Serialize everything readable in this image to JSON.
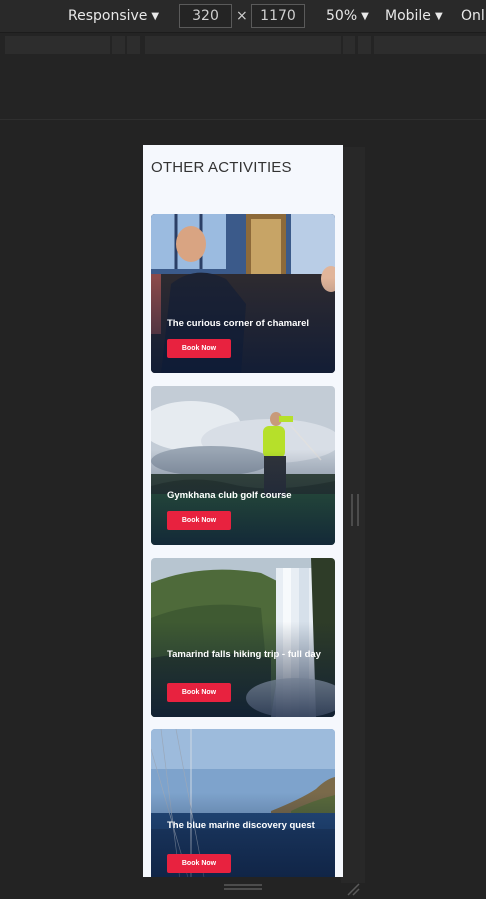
{
  "toolbar": {
    "mode_label": "Responsive",
    "width_value": "320",
    "times_symbol": "×",
    "height_value": "1170",
    "zoom_label": "50%",
    "device_label": "Mobile",
    "network_label": "Onli"
  },
  "page": {
    "section_title": "OTHER ACTIVITIES",
    "cards": [
      {
        "title": "The curious corner of chamarel",
        "button": "Book Now",
        "image": "restaurant-photo"
      },
      {
        "title": "Gymkhana club golf course",
        "button": "Book Now",
        "image": "golf-photo"
      },
      {
        "title": "Tamarind falls hiking trip - full day",
        "button": "Book Now",
        "image": "waterfall-photo"
      },
      {
        "title": "The blue marine discovery quest",
        "button": "Book Now",
        "image": "sailing-photo"
      }
    ]
  },
  "colors": {
    "accent": "#e8223f",
    "devtools_bg": "#232323",
    "page_bg": "#f5f8fd"
  }
}
